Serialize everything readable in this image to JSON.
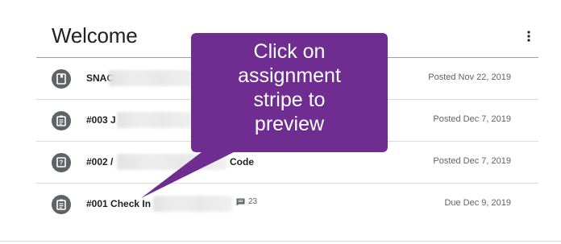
{
  "header": {
    "title": "Welcome",
    "menu_icon": "more-vert-icon"
  },
  "rows": [
    {
      "icon": "book-icon",
      "title": "SNAC",
      "suffix": "",
      "comments": "",
      "date": "Posted Nov 22, 2019"
    },
    {
      "icon": "assignment-icon",
      "title": "#003 J",
      "suffix": "",
      "comments": "",
      "date": "Posted Dec 7, 2019"
    },
    {
      "icon": "question-icon",
      "title": "#002 /",
      "suffix": "Code",
      "comments": "",
      "date": "Posted Dec 7, 2019"
    },
    {
      "icon": "assignment-icon",
      "title": "#001 Check In",
      "suffix": "",
      "comments": "23",
      "date": "Due Dec 9, 2019"
    }
  ],
  "callout": {
    "lines": [
      "Click on",
      "assignment",
      "stripe to",
      "preview"
    ],
    "color": "#6f2c91"
  }
}
